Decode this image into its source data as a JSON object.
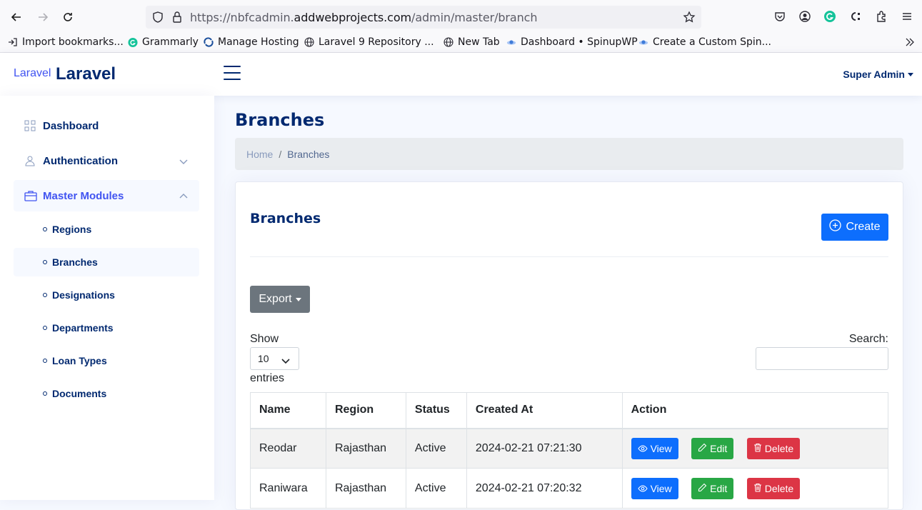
{
  "browser": {
    "url_prefix": "https://nbfcadmin.",
    "url_domain": "addwebprojects.com",
    "url_path": "/admin/master/branch",
    "bookmarks": [
      {
        "label": "Import bookmarks...",
        "icon": "import-icon"
      },
      {
        "label": "Grammarly",
        "icon": "grammarly-icon"
      },
      {
        "label": "Manage Hosting",
        "icon": "hosting-icon"
      },
      {
        "label": "Laravel 9 Repository ...",
        "icon": "globe-icon"
      },
      {
        "label": "New Tab",
        "icon": "globe-icon"
      },
      {
        "label": "Dashboard • SpinupWP",
        "icon": "spinupwp-icon"
      },
      {
        "label": "Create a Custom Spin...",
        "icon": "spinupwp-icon"
      }
    ]
  },
  "header": {
    "logo_small": "Laravel",
    "logo_big": "Laravel",
    "profile_name": "Super Admin"
  },
  "sidebar": {
    "items": [
      {
        "label": "Dashboard",
        "icon": "grid-icon"
      },
      {
        "label": "Authentication",
        "icon": "person-icon"
      },
      {
        "label": "Master Modules",
        "icon": "briefcase-icon"
      }
    ],
    "sub_items": [
      {
        "label": "Regions"
      },
      {
        "label": "Branches"
      },
      {
        "label": "Designations"
      },
      {
        "label": "Departments"
      },
      {
        "label": "Loan Types"
      },
      {
        "label": "Documents"
      }
    ]
  },
  "main": {
    "page_title": "Branches",
    "breadcrumb": {
      "home": "Home",
      "separator": "/",
      "current": "Branches"
    },
    "card_title": "Branches",
    "create_label": "Create",
    "export_label": "Export",
    "show_label": "Show",
    "page_length": "10",
    "entries_label": "entries",
    "search_label": "Search:",
    "search_value": "",
    "table": {
      "columns": [
        "Name",
        "Region",
        "Status",
        "Created At",
        "Action"
      ],
      "rows": [
        {
          "name": "Reodar",
          "region": "Rajasthan",
          "status": "Active",
          "created_at": "2024-02-21 07:21:30"
        },
        {
          "name": "Raniwara",
          "region": "Rajasthan",
          "status": "Active",
          "created_at": "2024-02-21 07:20:32"
        }
      ],
      "actions": {
        "view": "View",
        "edit": "Edit",
        "delete": "Delete"
      }
    }
  },
  "colors": {
    "primary": "#0d6efd",
    "success": "#28a745",
    "danger": "#dc3545",
    "secondary": "#6c757d",
    "navy": "#012970",
    "accent": "#4154f1"
  }
}
